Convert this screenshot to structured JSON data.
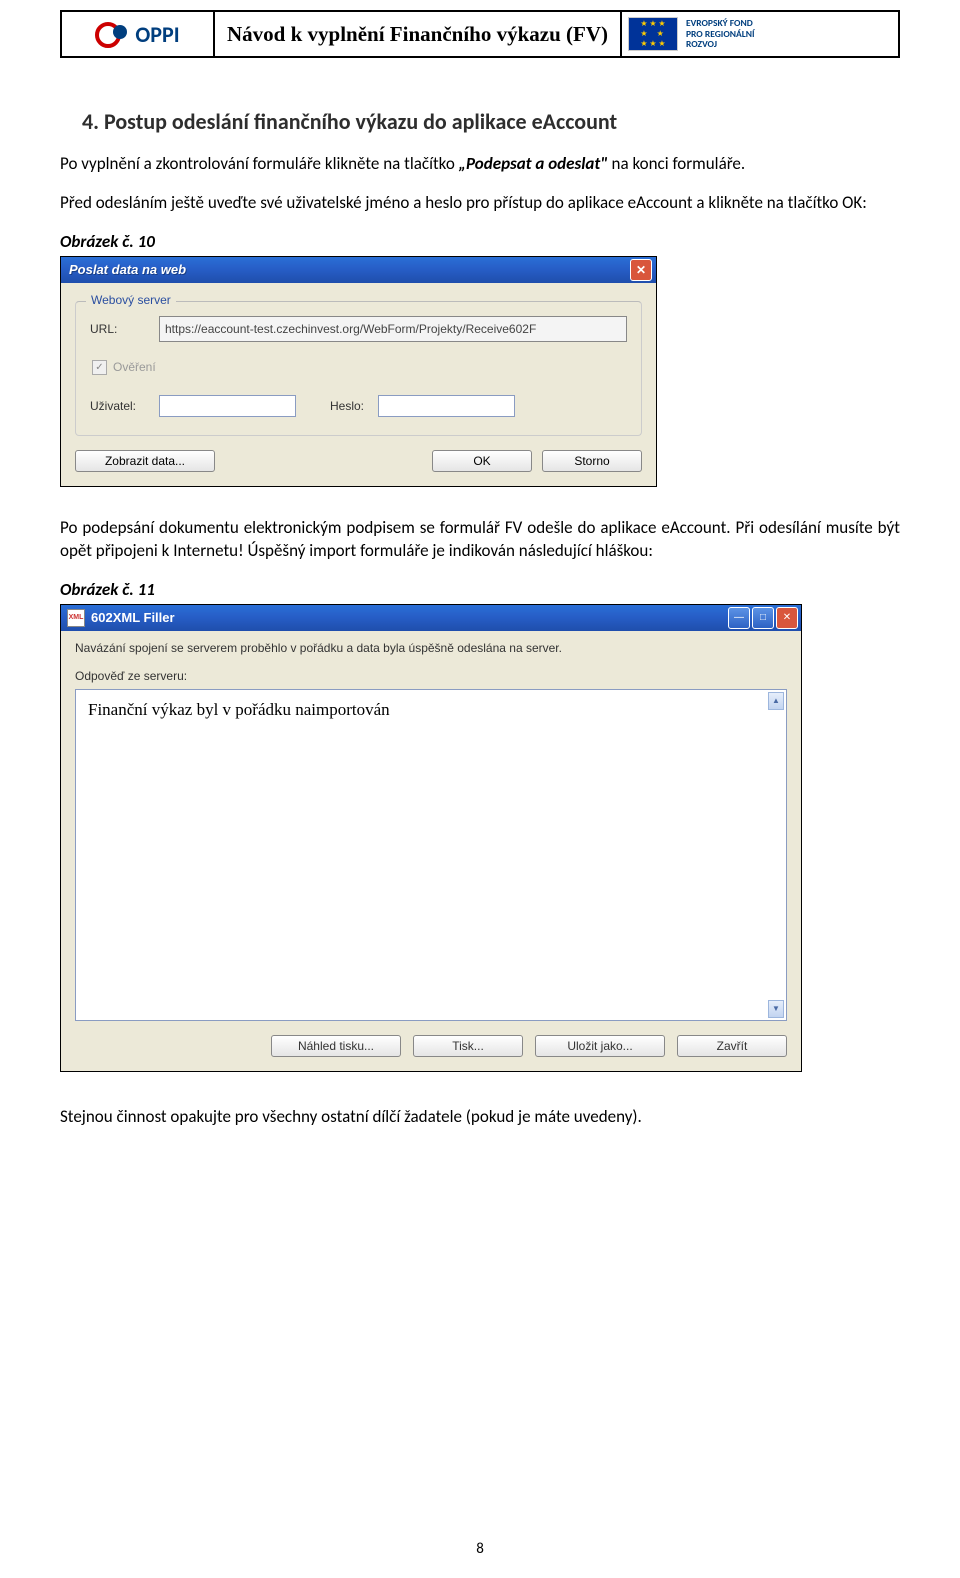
{
  "header": {
    "logo_text": "OPPI",
    "title": "Návod k vyplnění Finančního výkazu (FV)",
    "eu_lines": [
      "EVROPSKÝ FOND",
      "PRO REGIONÁLNÍ",
      "ROZVOJ"
    ]
  },
  "section": {
    "heading": "4. Postup odeslání finančního výkazu do aplikace eAccount",
    "para1_a": "Po vyplnění a zkontrolování formuláře klikněte na tlačítko ",
    "para1_b": "„Podepsat a odeslat\"",
    "para1_c": " na konci formuláře.",
    "para2": "Před odesláním ještě uveďte své uživatelské jméno a heslo pro přístup do aplikace eAccount a klikněte na tlačítko OK:",
    "fig1": "Obrázek č. 10",
    "para3": "Po podepsání dokumentu elektronickým podpisem se formulář FV odešle do aplikace eAccount. Při odesílání musíte být opět připojeni k Internetu! Úspěšný import formuláře je indikován následující hláškou:",
    "fig2": "Obrázek č. 11",
    "para4": "Stejnou činnost opakujte pro všechny ostatní dílčí žadatele (pokud je máte uvedeny)."
  },
  "dialog1": {
    "title": "Poslat data na web",
    "group_legend": "Webový server",
    "url_label": "URL:",
    "url_value": "https://eaccount-test.czechinvest.org/WebForm/Projekty/Receive602F",
    "verify_label": "Ověření",
    "user_label": "Uživatel:",
    "pass_label": "Heslo:",
    "btn_show": "Zobrazit data...",
    "btn_ok": "OK",
    "btn_cancel": "Storno"
  },
  "dialog2": {
    "title": "602XML Filler",
    "msg": "Navázání spojení se serverem proběhlo v pořádku a data byla úspěšně odeslána na server.",
    "reply_label": "Odpověď ze serveru:",
    "reply_text": "Finanční výkaz byl v pořádku naimportován",
    "btn_preview": "Náhled tisku...",
    "btn_print": "Tisk...",
    "btn_save": "Uložit jako...",
    "btn_close": "Zavřít"
  },
  "page_number": "8"
}
